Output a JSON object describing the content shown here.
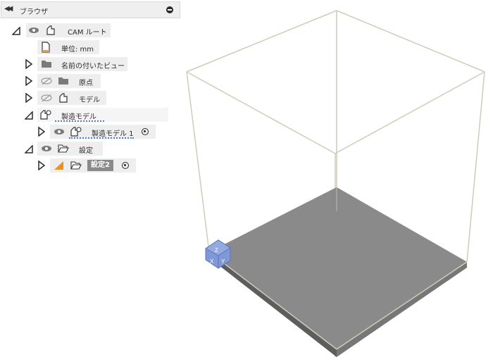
{
  "browser": {
    "title": "ブラウザ",
    "collapse_icon": "double-left-arrow",
    "minimize_icon": "minus-circle"
  },
  "tree": {
    "root": {
      "label": "CAM ルート",
      "icon": "component-icon"
    },
    "units": {
      "label": "単位: mm",
      "icon": "document-icon"
    },
    "named_views": {
      "label": "名前の付いたビュー",
      "icon": "folder-icon"
    },
    "origin": {
      "label": "原点",
      "icon": "folder-icon",
      "visible": false
    },
    "model": {
      "label": "モデル",
      "icon": "component-icon",
      "visible": false
    },
    "manufacturing_model": {
      "label": "製造モデル",
      "icon": "manufacturing-model-icon"
    },
    "manufacturing_model_1": {
      "label": "製造モデル 1",
      "icon": "manufacturing-model-icon"
    },
    "setups": {
      "label": "設定",
      "icon": "open-folder-icon"
    },
    "setup_2": {
      "label": "設定2",
      "icon": "setup-icon",
      "selected": true
    }
  },
  "colors": {
    "stock_top": "#8a8a8a",
    "stock_side": "#6e6e6e",
    "box_edge": "#c9c6b4",
    "selection": "#8a8a8a",
    "orientation_cube": "#7f99d6"
  },
  "viewcube": {
    "labels": [
      "Z",
      "X",
      "Y"
    ]
  }
}
